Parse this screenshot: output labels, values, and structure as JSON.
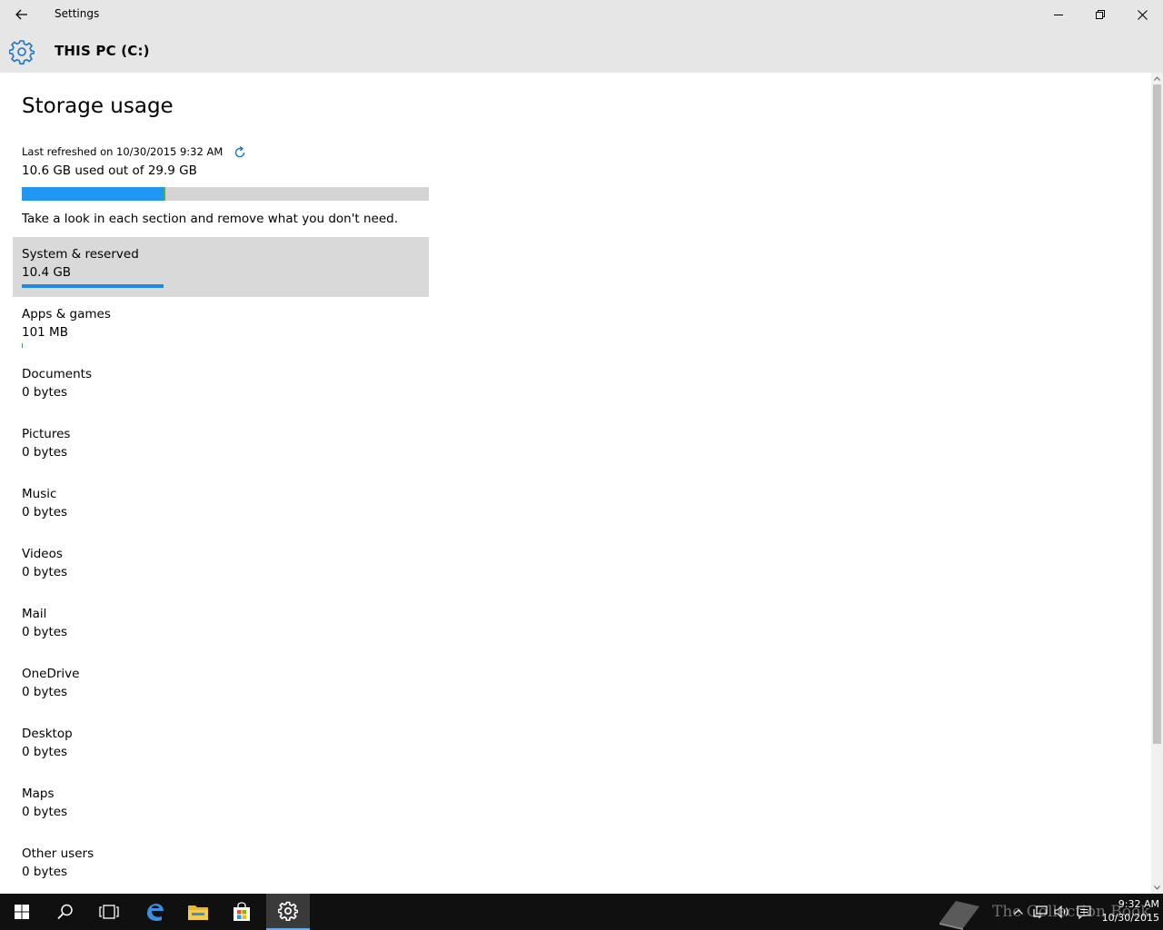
{
  "window": {
    "title": "Settings"
  },
  "header": {
    "title": "THIS PC (C:)"
  },
  "page": {
    "title": "Storage usage",
    "last_refreshed": "Last refreshed on 10/30/2015 9:32 AM",
    "used_text": "10.6 GB used out of 29.9 GB",
    "used_fraction": 0.355,
    "hint": "Take a look in each section and remove what you don't need."
  },
  "categories": [
    {
      "name": "System & reserved",
      "size": "10.4 GB",
      "fraction_of_total": 0.348,
      "selected": true
    },
    {
      "name": "Apps & games",
      "size": "101 MB",
      "fraction_of_total": 0.0034
    },
    {
      "name": "Documents",
      "size": "0 bytes",
      "fraction_of_total": 0
    },
    {
      "name": "Pictures",
      "size": "0 bytes",
      "fraction_of_total": 0
    },
    {
      "name": "Music",
      "size": "0 bytes",
      "fraction_of_total": 0
    },
    {
      "name": "Videos",
      "size": "0 bytes",
      "fraction_of_total": 0
    },
    {
      "name": "Mail",
      "size": "0 bytes",
      "fraction_of_total": 0
    },
    {
      "name": "OneDrive",
      "size": "0 bytes",
      "fraction_of_total": 0
    },
    {
      "name": "Desktop",
      "size": "0 bytes",
      "fraction_of_total": 0
    },
    {
      "name": "Maps",
      "size": "0 bytes",
      "fraction_of_total": 0
    },
    {
      "name": "Other users",
      "size": "0 bytes",
      "fraction_of_total": 0
    }
  ],
  "taskbar": {
    "watermark": "The Collection Book",
    "time": "9:32 AM",
    "date": "10/30/2015"
  },
  "colors": {
    "accent": "#1e88e5",
    "chrome_bg": "#e6e6e6",
    "taskbar_bg": "#101010"
  }
}
